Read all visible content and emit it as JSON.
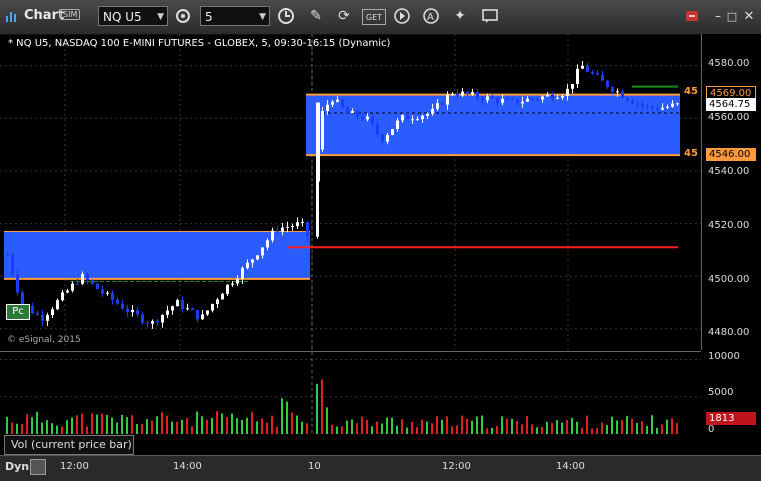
{
  "toolbar": {
    "app_title": "Chart",
    "sim_badge": "SIM",
    "symbol": "NQ U5",
    "interval": "5"
  },
  "chart": {
    "title": "* NQ U5, NASDAQ 100 E-MINI FUTURES - GLOBEX, 5, 09:30-16:15 (Dynamic)",
    "watermark": "© eSignal, 2015",
    "pc_label": "Pc",
    "price_labels": [
      "4580.00",
      "4560.00",
      "4540.00",
      "4520.00",
      "4500.00",
      "4480.00"
    ],
    "current_price": "4564.75",
    "upper_level": "4569.00",
    "lower_level": "4546.00",
    "clipped_left_label_upper": "45",
    "clipped_left_label_lower": "45",
    "day_marker": "10",
    "colors": {
      "up": "#ffffff",
      "down": "#1a3cff",
      "box": "#2a5cff",
      "level": "#ff9a3c",
      "prev_close": "#ff2020",
      "tag_current": "#ffffff",
      "tag_level": "#ff9a3c"
    }
  },
  "volume": {
    "pane_label": "Vol (current price bar)",
    "axis_labels": [
      "10000",
      "5000",
      "0"
    ],
    "current": "1813"
  },
  "time_axis": {
    "labels": [
      "12:00",
      "14:00",
      "10",
      "12:00",
      "14:00"
    ]
  },
  "bottom": {
    "dyn_label": "Dyn"
  },
  "chart_data": {
    "type": "candlestick",
    "title": "* NQ U5, NASDAQ 100 E-MINI FUTURES - GLOBEX, 5, 09:30-16:15 (Dynamic)",
    "ylim": [
      4472,
      4592
    ],
    "levels": {
      "upper": 4569.0,
      "lower": 4546.0,
      "current": 4564.75
    },
    "volume_ylim": [
      0,
      11000
    ],
    "volume_current": 1813
  }
}
